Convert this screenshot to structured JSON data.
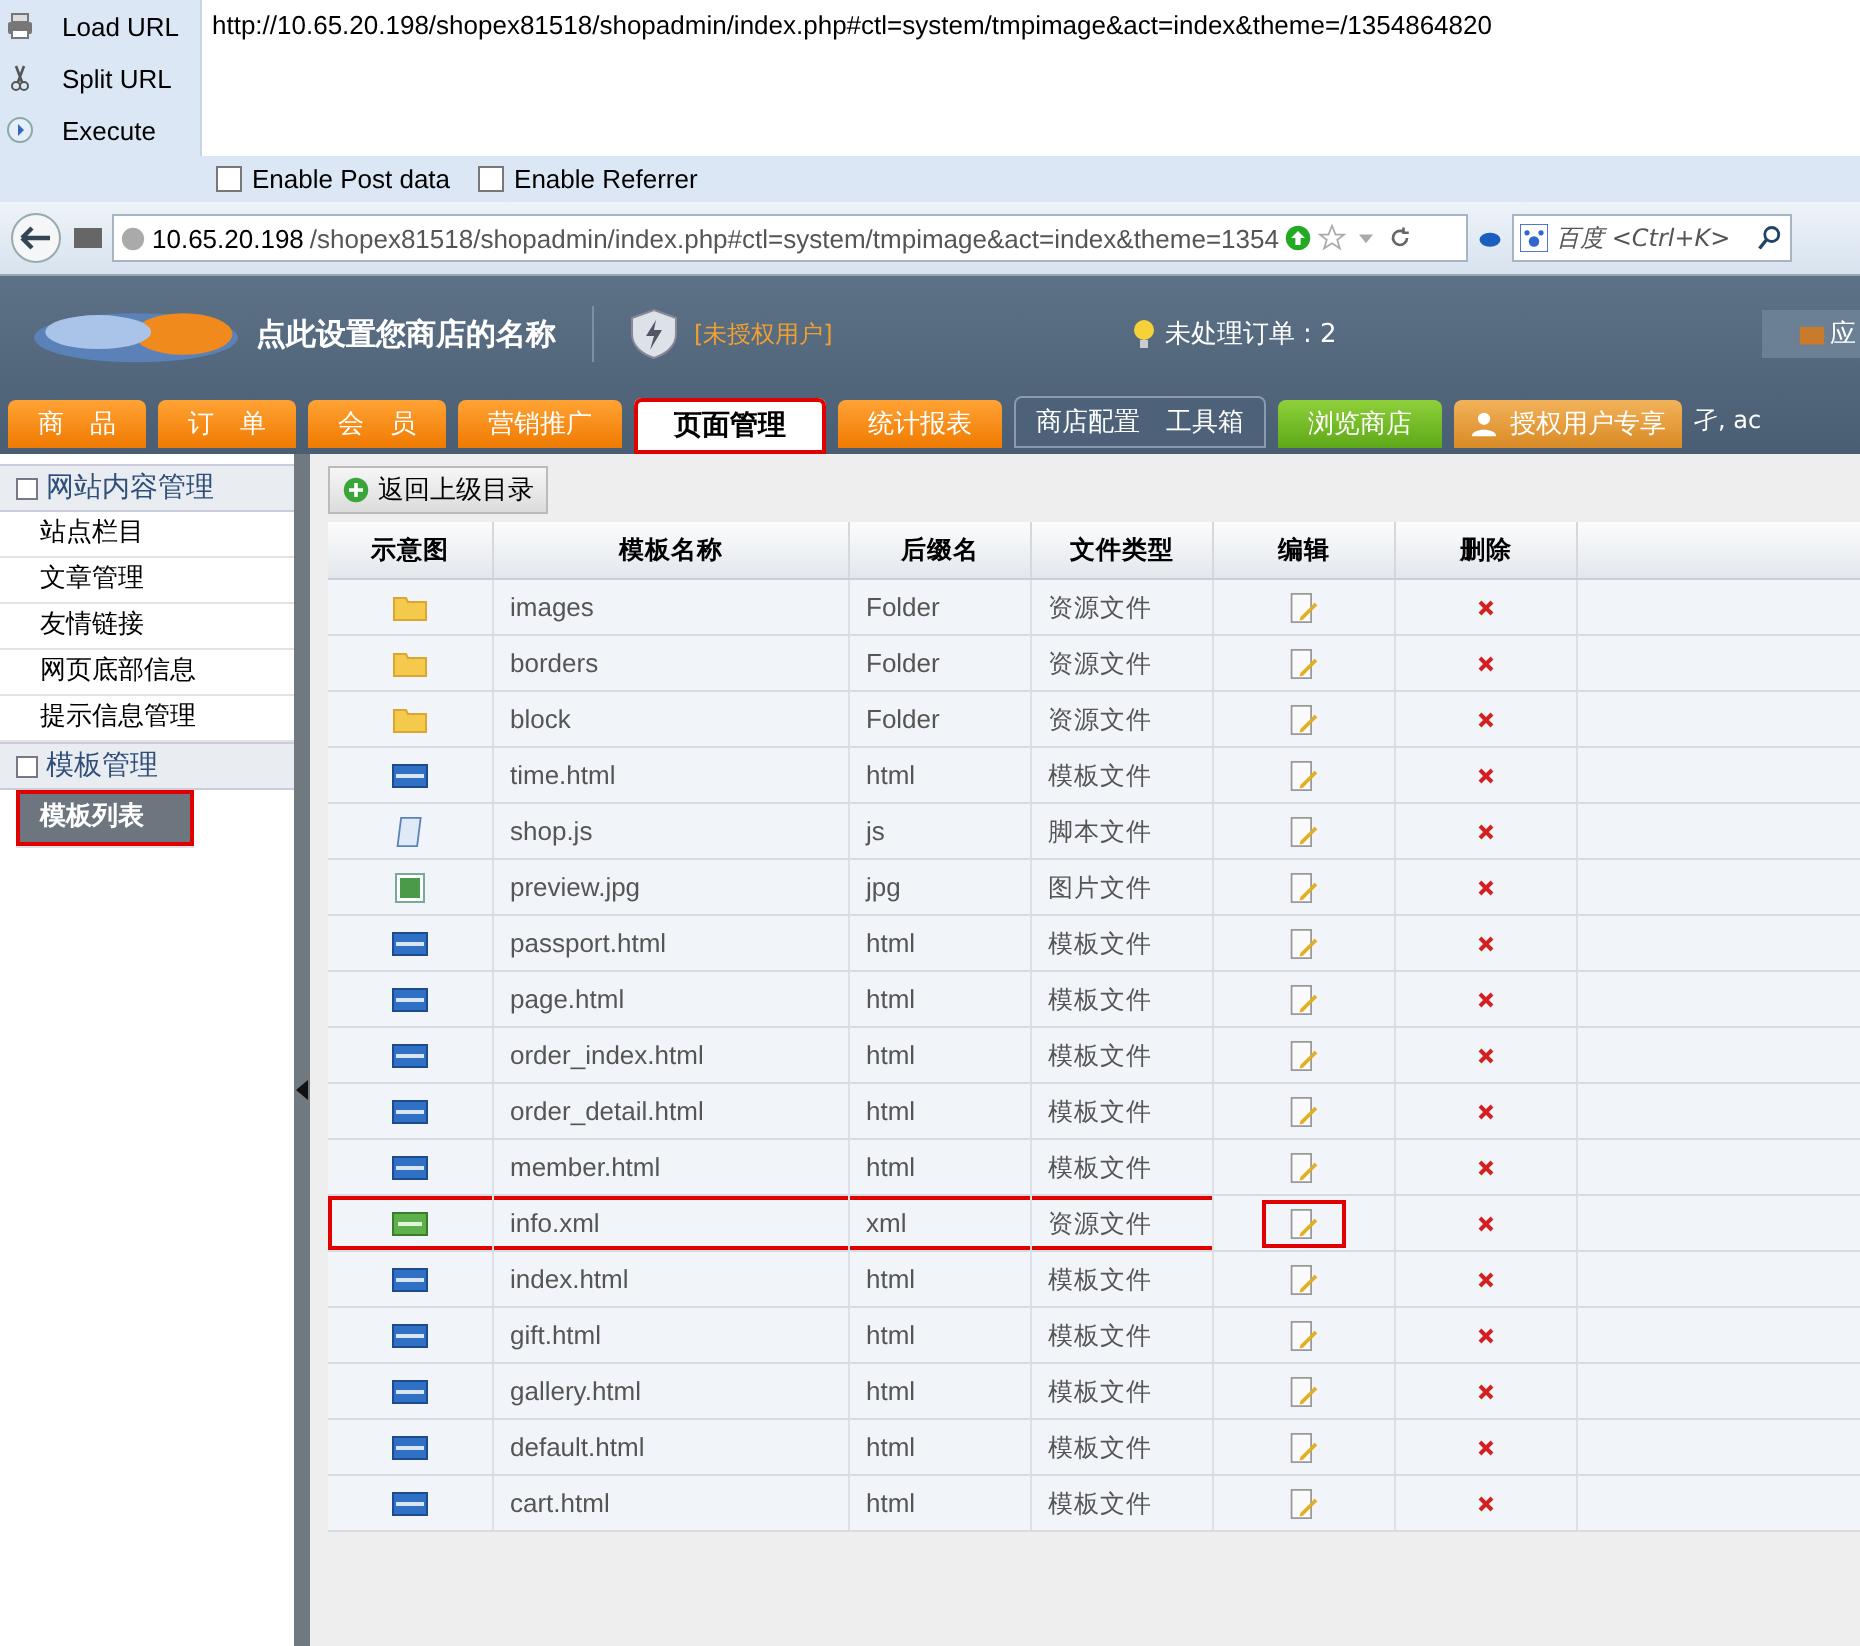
{
  "hackbar": {
    "actions": [
      {
        "label": "Load URL",
        "kind": "load"
      },
      {
        "label": "Split URL",
        "kind": "split"
      },
      {
        "label": "Execute",
        "kind": "execute"
      }
    ],
    "url": "http://10.65.20.198/shopex81518/shopadmin/index.php#ctl=system/tmpimage&act=index&theme=/1354864820",
    "options": [
      {
        "label": "Enable Post data",
        "checked": false
      },
      {
        "label": "Enable Referrer",
        "checked": false
      }
    ]
  },
  "browser": {
    "host": "10.65.20.198",
    "path": "/shopex81518/shopadmin/index.php#ctl=system/tmpimage&act=index&theme=1354",
    "search_placeholder": "百度 <Ctrl+K>"
  },
  "header": {
    "shop_name": "点此设置您商店的名称",
    "license": "[未授权用户]",
    "orders": "未处理订单 : 2",
    "corner": "应",
    "user": "孑, ac"
  },
  "tabs": [
    {
      "label": "商　品",
      "kind": "orange",
      "selected": false,
      "marked": false
    },
    {
      "label": "订　单",
      "kind": "orange",
      "selected": false,
      "marked": false
    },
    {
      "label": "会　员",
      "kind": "orange",
      "selected": false,
      "marked": false
    },
    {
      "label": "营销推广",
      "kind": "orange",
      "selected": false,
      "marked": false
    },
    {
      "label": "页面管理",
      "kind": "orange",
      "selected": true,
      "marked": true
    },
    {
      "label": "统计报表",
      "kind": "orange",
      "selected": false,
      "marked": false
    },
    {
      "label": "商店配置　工具箱",
      "kind": "dark",
      "selected": false,
      "marked": false
    },
    {
      "label": "浏览商店",
      "kind": "green",
      "selected": false,
      "marked": false
    },
    {
      "label": "授权用户专享",
      "kind": "gold",
      "selected": false,
      "marked": false
    }
  ],
  "sidebar": [
    {
      "title": "网站内容管理",
      "items": [
        {
          "label": "站点栏目",
          "selected": false,
          "marked": false
        },
        {
          "label": "文章管理",
          "selected": false,
          "marked": false
        },
        {
          "label": "友情链接",
          "selected": false,
          "marked": false
        },
        {
          "label": "网页底部信息",
          "selected": false,
          "marked": false
        },
        {
          "label": "提示信息管理",
          "selected": false,
          "marked": false
        }
      ]
    },
    {
      "title": "模板管理",
      "items": [
        {
          "label": "模板列表",
          "selected": true,
          "marked": true
        }
      ]
    }
  ],
  "back_button": "返回上级目录",
  "table": {
    "columns": [
      "示意图",
      "模板名称",
      "后缀名",
      "文件类型",
      "编辑",
      "删除"
    ],
    "rows": [
      {
        "kind": "folder",
        "name": "images",
        "ext": "Folder",
        "type": "资源文件",
        "marked": false
      },
      {
        "kind": "folder",
        "name": "borders",
        "ext": "Folder",
        "type": "资源文件",
        "marked": false
      },
      {
        "kind": "folder",
        "name": "block",
        "ext": "Folder",
        "type": "资源文件",
        "marked": false
      },
      {
        "kind": "html",
        "name": "time.html",
        "ext": "html",
        "type": "模板文件",
        "marked": false
      },
      {
        "kind": "script",
        "name": "shop.js",
        "ext": "js",
        "type": "脚本文件",
        "marked": false
      },
      {
        "kind": "image",
        "name": "preview.jpg",
        "ext": "jpg",
        "type": "图片文件",
        "marked": false
      },
      {
        "kind": "html",
        "name": "passport.html",
        "ext": "html",
        "type": "模板文件",
        "marked": false
      },
      {
        "kind": "html",
        "name": "page.html",
        "ext": "html",
        "type": "模板文件",
        "marked": false
      },
      {
        "kind": "html",
        "name": "order_index.html",
        "ext": "html",
        "type": "模板文件",
        "marked": false
      },
      {
        "kind": "html",
        "name": "order_detail.html",
        "ext": "html",
        "type": "模板文件",
        "marked": false
      },
      {
        "kind": "html",
        "name": "member.html",
        "ext": "html",
        "type": "模板文件",
        "marked": false
      },
      {
        "kind": "xml",
        "name": "info.xml",
        "ext": "xml",
        "type": "资源文件",
        "marked": true
      },
      {
        "kind": "html",
        "name": "index.html",
        "ext": "html",
        "type": "模板文件",
        "marked": false
      },
      {
        "kind": "html",
        "name": "gift.html",
        "ext": "html",
        "type": "模板文件",
        "marked": false
      },
      {
        "kind": "html",
        "name": "gallery.html",
        "ext": "html",
        "type": "模板文件",
        "marked": false
      },
      {
        "kind": "html",
        "name": "default.html",
        "ext": "html",
        "type": "模板文件",
        "marked": false
      },
      {
        "kind": "html",
        "name": "cart.html",
        "ext": "html",
        "type": "模板文件",
        "marked": false
      }
    ]
  }
}
